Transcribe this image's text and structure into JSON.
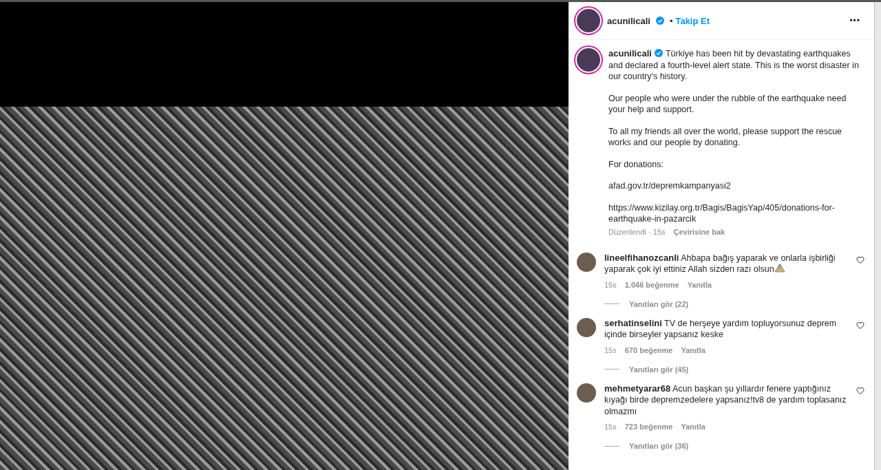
{
  "post": {
    "username": "acunilicali",
    "verified": true,
    "separator": "•",
    "follow": "Takip Et",
    "more": "•••"
  },
  "caption": {
    "username": "acunilicali",
    "verified": true,
    "paragraphs": [
      "Türkiye has been hit by devastating earthquakes and declared a fourth-level alert state. This is the worst disaster in our country's history.",
      "Our people who were under the rubble of the earthquake need your help and support.",
      "To all my friends all over the world, please support the rescue works and our people by donating.",
      "For donations:",
      "afad.gov.tr/depremkampanyasi2",
      "https://www.kizilay.org.tr/Bagis/BagisYap/405/donations-for-earthquake-in-pazarcik"
    ],
    "edited": "Düzenlendi · 15s",
    "translate": "Çevirisine bak"
  },
  "comments": [
    {
      "username": "lineelfihanozcanli",
      "text": "Ahbapa bağış yaparak ve onlarla işbirliği yaparak çok iyi ettiniz Allah sizden razı olsun",
      "emoji": true,
      "liked": false,
      "time": "15s",
      "likes": "1.046 beğenme",
      "reply": "Yanıtla",
      "replies": "Yanıtları gör (22)"
    },
    {
      "username": "serhatinselini",
      "text": "TV de herşeye yardım topluyorsunuz deprem içinde birseyler yapsanız keske",
      "emoji": false,
      "liked": false,
      "time": "15s",
      "likes": "670 beğenme",
      "reply": "Yanıtla",
      "replies": "Yanıtları gör (45)"
    },
    {
      "username": "mehmetyarar68",
      "text": "Acun başkan şu yıllardır fenere yaptığınız kıyağı birde depremzedelere yapsanız!tv8 de yardım toplasanız olmazmı",
      "emoji": false,
      "liked": false,
      "time": "15s",
      "likes": "723 beğenme",
      "reply": "Yanıtla",
      "replies": "Yanıtları gör (36)"
    }
  ]
}
